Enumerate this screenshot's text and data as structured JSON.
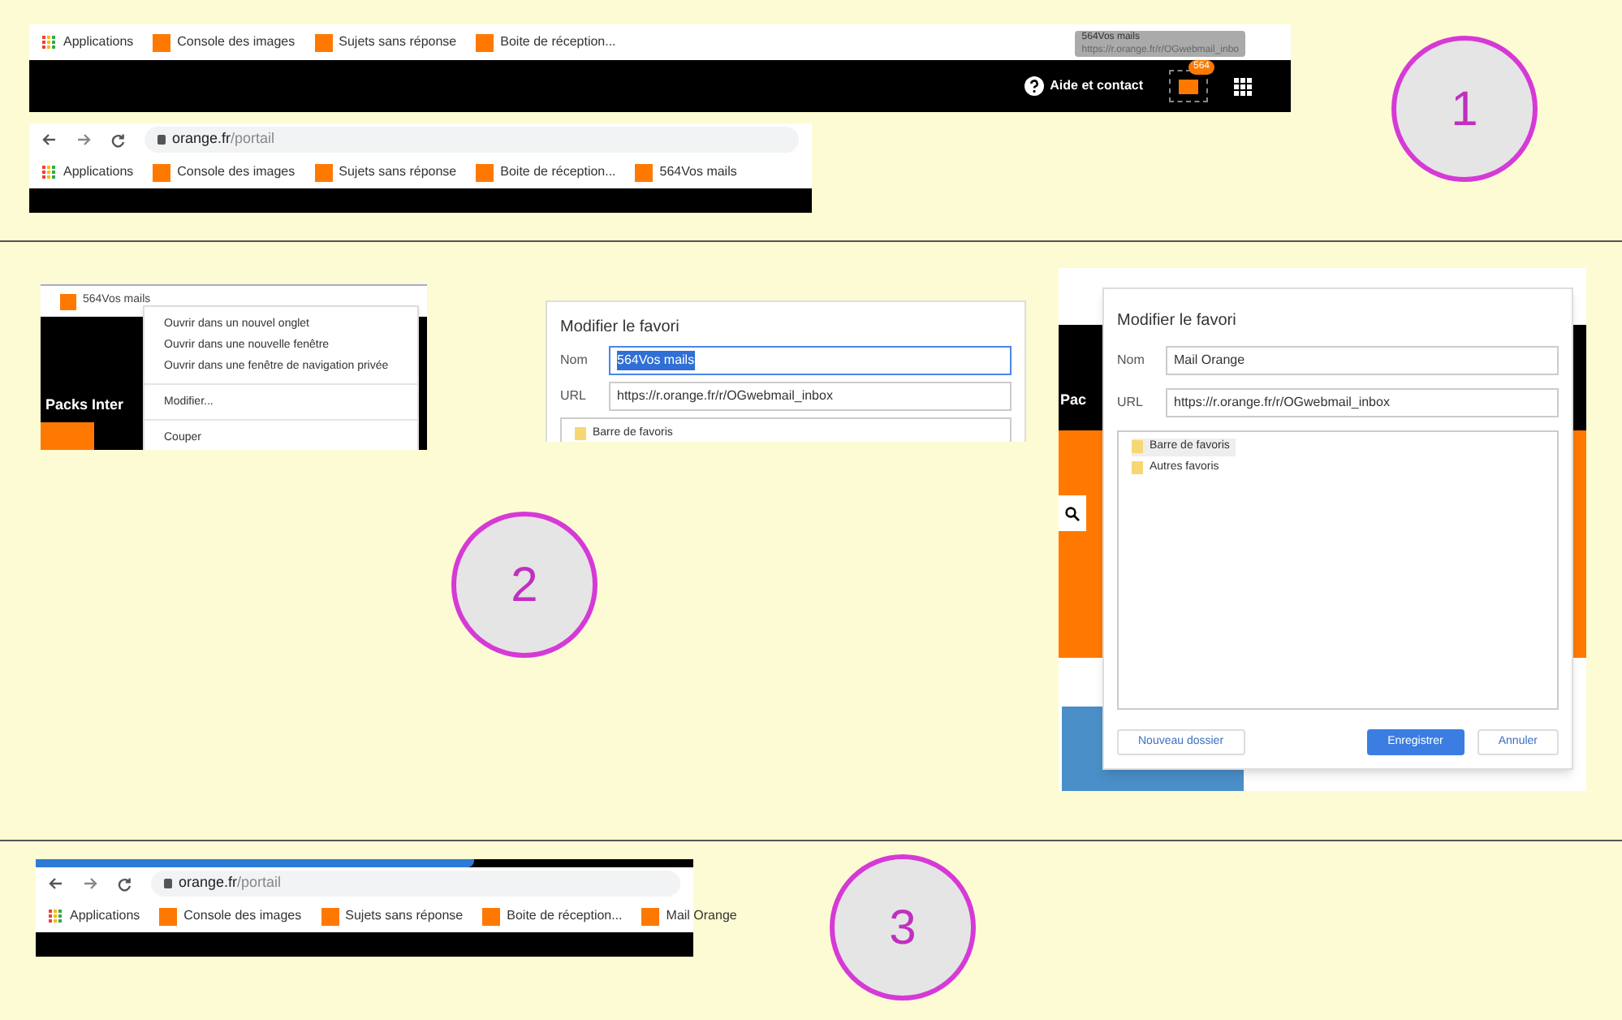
{
  "steps": [
    {
      "number": "1"
    },
    {
      "number": "2"
    },
    {
      "number": "3"
    }
  ],
  "step1": {
    "top_bar": {
      "bookmarks": [
        {
          "kind": "apps",
          "label": "Applications"
        },
        {
          "kind": "orange",
          "label": "Console des images"
        },
        {
          "kind": "orange",
          "label": "Sujets sans réponse"
        },
        {
          "kind": "orange",
          "label": "Boite de réception..."
        }
      ],
      "help_link": "Aide et contact",
      "mail_badge": "564",
      "tooltip": {
        "title": "564Vos mails",
        "url": "https://r.orange.fr/r/OGwebmail_inbo"
      }
    },
    "browser": {
      "address_host": "orange.fr",
      "address_path": "/portail",
      "bookmarks": [
        {
          "kind": "apps",
          "label": "Applications"
        },
        {
          "kind": "orange",
          "label": "Console des images"
        },
        {
          "kind": "orange",
          "label": "Sujets sans réponse"
        },
        {
          "kind": "orange",
          "label": "Boite de réception..."
        },
        {
          "kind": "orange",
          "label": "564Vos mails"
        }
      ]
    }
  },
  "step2": {
    "context_menu": {
      "bookmark": "564Vos mails",
      "page_text": "Packs Inter",
      "items": [
        {
          "label": "Ouvrir dans un nouvel onglet",
          "separator_before": false
        },
        {
          "label": "Ouvrir dans une nouvelle fenêtre",
          "separator_before": false
        },
        {
          "label": "Ouvrir dans une fenêtre de navigation privée",
          "separator_before": false
        },
        {
          "label": "Modifier...",
          "separator_before": true
        },
        {
          "label": "Couper",
          "separator_before": true
        }
      ]
    },
    "dialog_before": {
      "title": "Modifier le favori",
      "name_label": "Nom",
      "name_value": "564Vos mails",
      "name_selected": true,
      "url_label": "URL",
      "url_value": "https://r.orange.fr/r/OGwebmail_inbox",
      "folders": [
        {
          "label": "Barre de favoris"
        }
      ]
    },
    "dialog_after": {
      "page_text": "Pac",
      "title": "Modifier le favori",
      "name_label": "Nom",
      "name_value": "Mail Orange",
      "name_selected": false,
      "url_label": "URL",
      "url_value": "https://r.orange.fr/r/OGwebmail_inbox",
      "folders": [
        {
          "label": "Barre de favoris",
          "selected": true
        },
        {
          "label": "Autres favoris",
          "selected": false
        }
      ],
      "buttons": [
        {
          "label": "Nouveau dossier",
          "primary": false
        },
        {
          "label": "Enregistrer",
          "primary": true
        },
        {
          "label": "Annuler",
          "primary": false
        }
      ]
    }
  },
  "step3": {
    "browser": {
      "address_host": "orange.fr",
      "address_path": "/portail",
      "bookmarks": [
        {
          "kind": "apps",
          "label": "Applications"
        },
        {
          "kind": "orange",
          "label": "Console des images"
        },
        {
          "kind": "orange",
          "label": "Sujets sans réponse"
        },
        {
          "kind": "orange",
          "label": "Boite de réception..."
        },
        {
          "kind": "orange",
          "label": "Mail Orange"
        }
      ]
    }
  }
}
